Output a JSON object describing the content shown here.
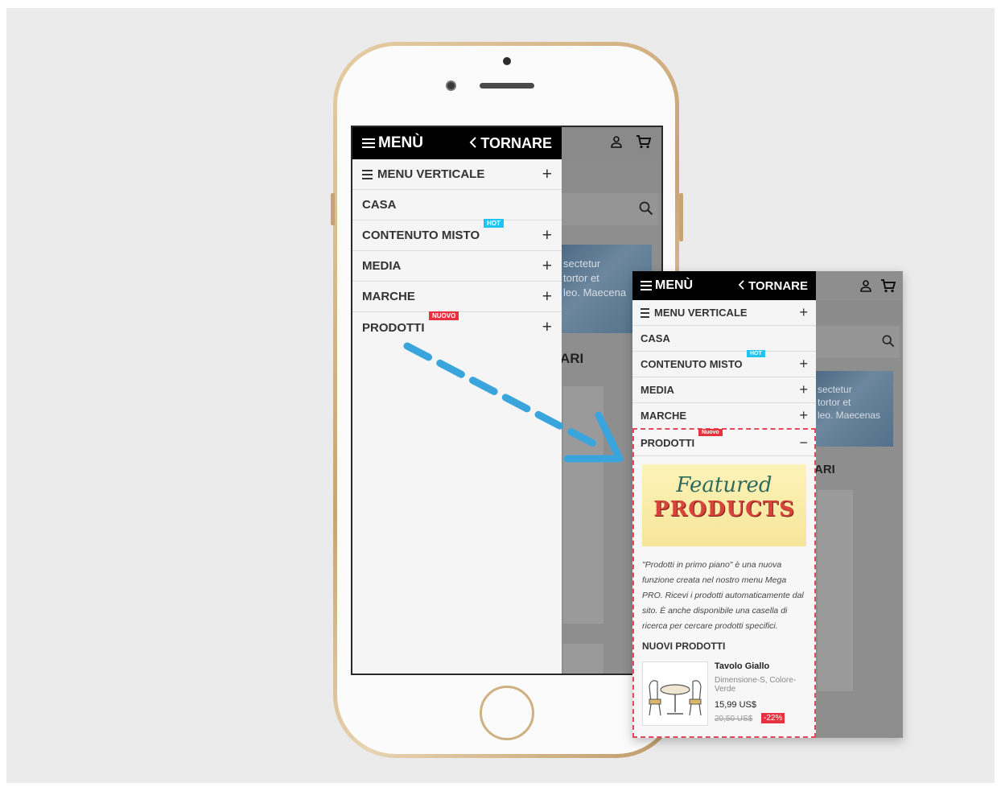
{
  "colors": {
    "header": "#000000",
    "hot_badge": "#1ec5f0",
    "new_badge": "#e8303e",
    "arrow": "#3aa5dc",
    "highlight": "#e0485d"
  },
  "drawer": {
    "title": "MENÙ",
    "back_label": "TORNARE",
    "items": [
      {
        "label": "MENU VERTICALE",
        "icon": "burger-icon",
        "expandable": true
      },
      {
        "label": "CASA",
        "expandable": false
      },
      {
        "label": "CONTENUTO MISTO",
        "badge": "HOT",
        "expandable": true
      },
      {
        "label": "MEDIA",
        "expandable": true
      },
      {
        "label": "MARCHE",
        "expandable": true
      },
      {
        "label": "PRODOTTI",
        "badge": "Nuovo",
        "expandable": true
      }
    ]
  },
  "background": {
    "img_text": [
      "sectetur",
      "tortor et",
      "leo. Maecena"
    ],
    "zoom_img_text": [
      "sectetur",
      "tortor et",
      "leo. Maecenas"
    ],
    "heading_fragment": "ARI"
  },
  "expanded": {
    "banner_line1": "Featured",
    "banner_line2": "PRODUCTS",
    "description": "\"Prodotti in primo piano\" è una nuova funzione creata nel nostro menu Mega PRO. Ricevi i prodotti automaticamente dal sito. È anche disponibile una casella di ricerca per cercare prodotti specifici.",
    "section_title": "NUOVI PRODOTTI",
    "product": {
      "name": "Tavolo Giallo",
      "attributes": "Dimensione-S, Colore-Verde",
      "price": "15,99 US$",
      "old_price": "20,50 US$",
      "discount": "-22%"
    }
  }
}
